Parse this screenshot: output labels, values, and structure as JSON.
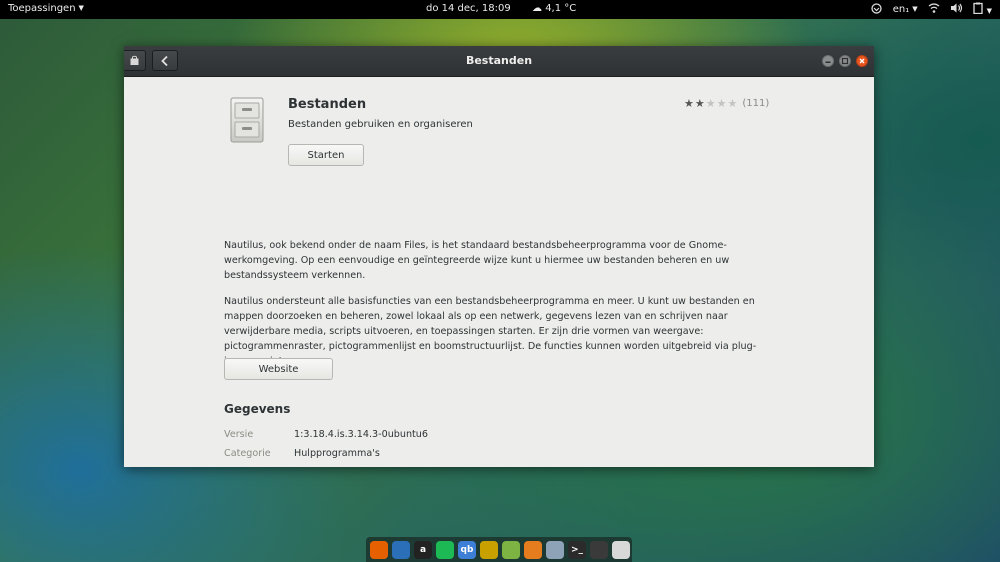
{
  "topbar": {
    "apps_label": "Toepassingen",
    "clock": "do 14 dec, 18:09",
    "weather": "4,1 °C",
    "language": "en₁"
  },
  "window": {
    "title": "Bestanden"
  },
  "app": {
    "name": "Bestanden",
    "summary": "Bestanden gebruiken en organiseren",
    "launch_label": "Starten",
    "rating": {
      "stars": 2,
      "max": 5,
      "count": "(111)"
    },
    "description": [
      "Nautilus, ook bekend onder de naam Files, is het standaard bestandsbeheerprogramma voor de Gnome-werkomgeving. Op een eenvoudige en geïntegreerde wijze kunt u hiermee uw bestanden beheren en uw bestandssysteem verkennen.",
      "Nautilus ondersteunt alle basisfuncties van een bestandsbeheerprogramma en meer. U kunt uw bestanden en mappen doorzoeken en beheren, zowel lokaal als op een netwerk, gegevens lezen van en schrijven naar verwijderbare media, scripts uitvoeren, en toepassingen starten. Er zijn drie vormen van weergave: pictogrammenraster, pictogrammenlijst en boomstructuurlijst. De functies kunnen worden uitgebreid via plug-ins en scripts."
    ],
    "website_label": "Website"
  },
  "details": {
    "title": "Gegevens",
    "rows": [
      {
        "label": "Versie",
        "value": "1:3.18.4.is.3.14.3-0ubuntu6"
      },
      {
        "label": "Categorie",
        "value": "Hulpprogramma's"
      }
    ]
  },
  "dock": {
    "items": [
      {
        "name": "firefox-icon",
        "color": "#e66000",
        "glyph": ""
      },
      {
        "name": "thunderbird-icon",
        "color": "#2a6fb8",
        "glyph": ""
      },
      {
        "name": "software-center-icon",
        "color": "#222222",
        "glyph": "a"
      },
      {
        "name": "spotify-icon",
        "color": "#1db954",
        "glyph": ""
      },
      {
        "name": "qbittorrent-icon",
        "color": "#3d7fd6",
        "glyph": "qb"
      },
      {
        "name": "filezilla-icon",
        "color": "#c8a000",
        "glyph": ""
      },
      {
        "name": "rss-icon",
        "color": "#7cb342",
        "glyph": ""
      },
      {
        "name": "settings-icon",
        "color": "#e57d1f",
        "glyph": ""
      },
      {
        "name": "files-icon",
        "color": "#8fa3b8",
        "glyph": ""
      },
      {
        "name": "terminal-icon",
        "color": "#2b2b2b",
        "glyph": ">_"
      },
      {
        "name": "privacy-icon",
        "color": "#3a3a3a",
        "glyph": ""
      },
      {
        "name": "trash-icon",
        "color": "#d8d8d8",
        "glyph": ""
      }
    ]
  }
}
